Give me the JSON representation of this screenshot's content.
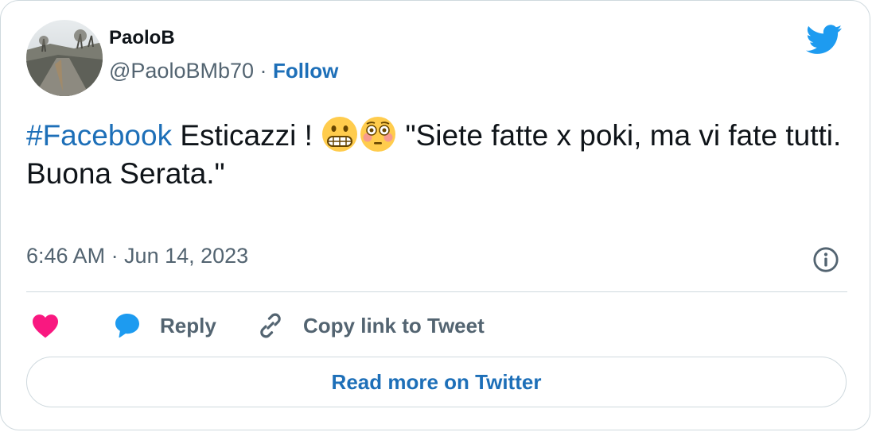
{
  "author": {
    "name": "PaoloB",
    "handle": "@PaoloBMb70",
    "separator": "·",
    "follow_label": "Follow"
  },
  "tweet": {
    "hashtag": "#Facebook",
    "text_part1": "Esticazzi !",
    "emojis": [
      "grimacing-face",
      "flushed-face"
    ],
    "text_part2": "\"Siete fatte x poki, ma vi fate tutti.",
    "text_line2": "Buona Serata.\""
  },
  "meta": {
    "timestamp": "6:46 AM · Jun 14, 2023"
  },
  "actions": {
    "reply_label": "Reply",
    "copy_label": "Copy link to Tweet"
  },
  "footer": {
    "read_more_label": "Read more on Twitter"
  },
  "colors": {
    "link": "#1d6fb8",
    "muted": "#536471",
    "border": "#cfd9de",
    "like": "#f91880",
    "reply": "#1d9bf0",
    "bird": "#1d9bf0"
  },
  "icons": {
    "brand": "twitter-bird-icon",
    "info": "info-icon",
    "like": "heart-icon",
    "reply": "speech-bubble-icon",
    "copy": "link-icon"
  }
}
